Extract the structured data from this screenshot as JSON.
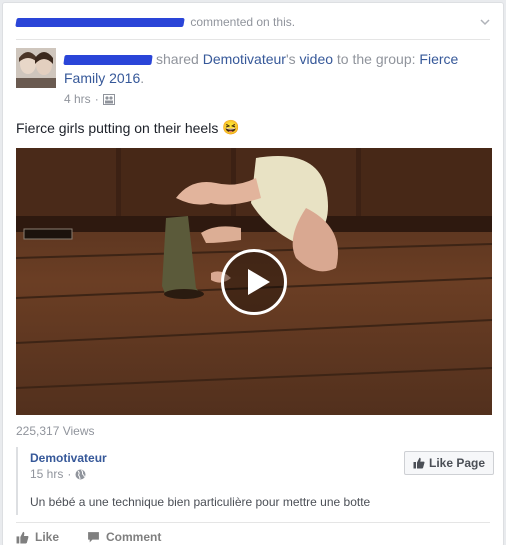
{
  "activity": {
    "text": "commented on this."
  },
  "post": {
    "shared_text": "shared",
    "page_name": "Demotivateur",
    "possessive": "'s",
    "video_word": "video",
    "to_group_text": "to the group:",
    "group_name": "Fierce Family 2016",
    "period": ".",
    "time": "4 hrs",
    "dot": "·",
    "message": "Fierce girls putting on their heels",
    "emoji": "😆"
  },
  "video": {
    "views": "225,317 Views"
  },
  "embed": {
    "page_name": "Demotivateur",
    "time": "15 hrs",
    "dot": "·",
    "like_page_label": "Like Page",
    "description": "Un bébé a une technique bien particulière pour mettre une botte"
  },
  "actions": {
    "like": "Like",
    "comment": "Comment"
  },
  "colors": {
    "link": "#365899",
    "muted": "#90949c",
    "redaction": "#2a45d8"
  },
  "icons": [
    "chevron-down-icon",
    "group-privacy-icon",
    "play-icon",
    "globe-icon",
    "thumbs-up-icon",
    "comment-icon"
  ]
}
